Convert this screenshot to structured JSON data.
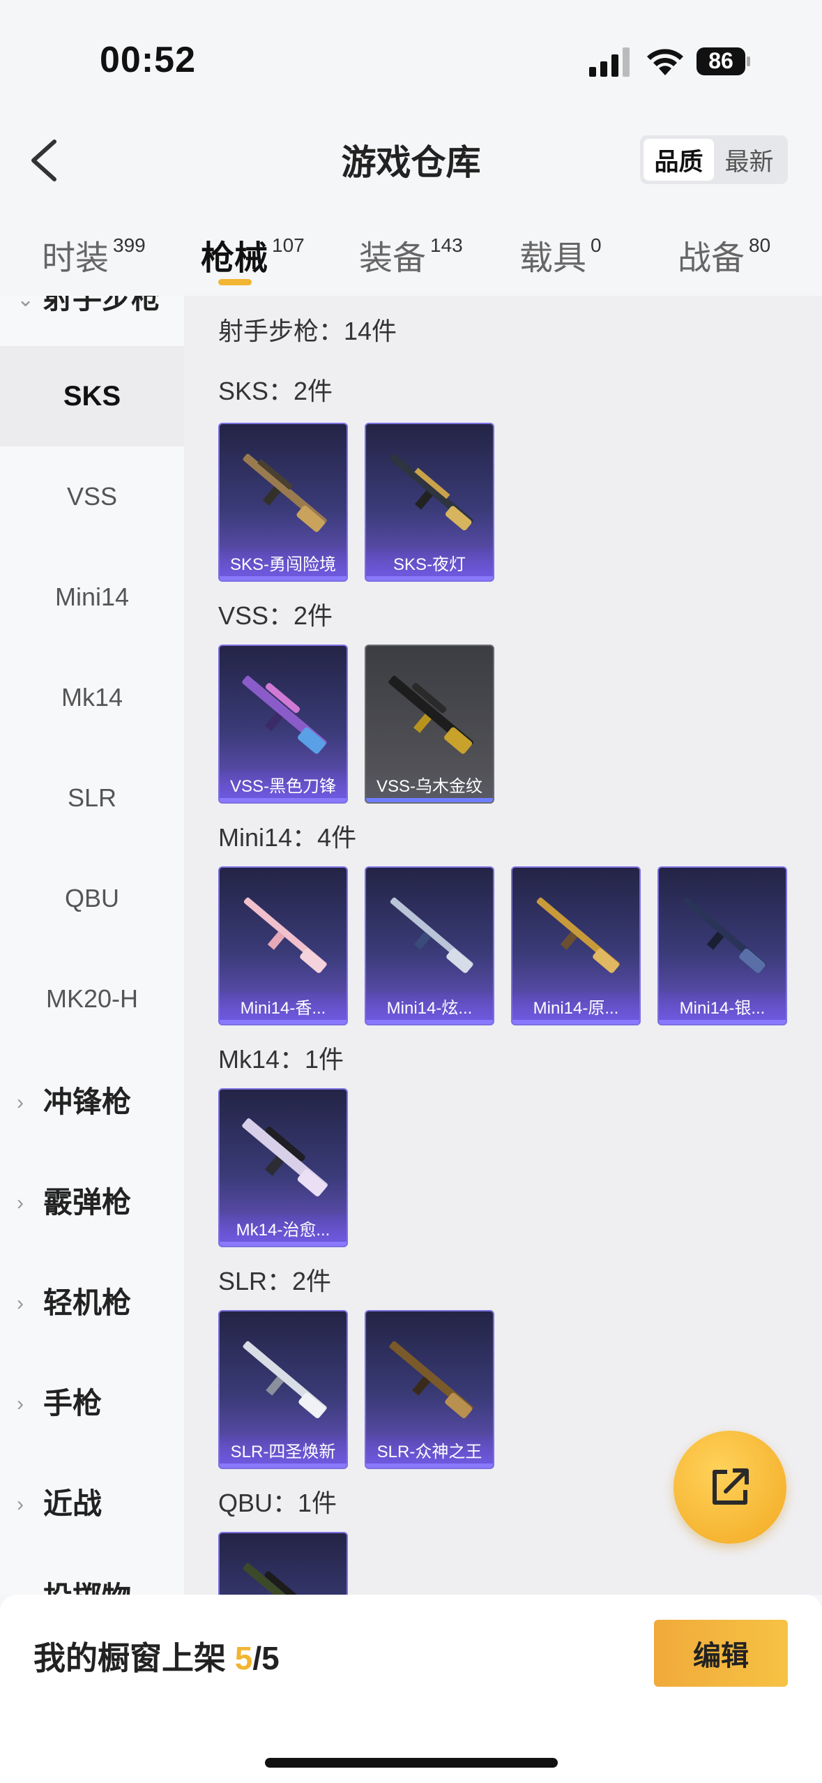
{
  "status": {
    "time": "00:52",
    "battery": "86"
  },
  "header": {
    "title": "游戏仓库",
    "sort_options": [
      "品质",
      "最新"
    ],
    "sort_active": "品质"
  },
  "tabs": [
    {
      "label": "时装",
      "count": "399"
    },
    {
      "label": "枪械",
      "count": "107",
      "active": true
    },
    {
      "label": "装备",
      "count": "143"
    },
    {
      "label": "载具",
      "count": "0"
    },
    {
      "label": "战备",
      "count": "80"
    }
  ],
  "sidebar": {
    "category_partial": "射手步枪",
    "items": [
      "SKS",
      "VSS",
      "Mini14",
      "Mk14",
      "SLR",
      "QBU",
      "MK20-H"
    ],
    "active_item": "SKS",
    "groups": [
      "冲锋枪",
      "霰弹枪",
      "轻机枪",
      "手枪",
      "近战"
    ],
    "group_partial": "投掷物"
  },
  "main": {
    "category_title": "射手步枪：14件",
    "sections": [
      {
        "title": "SKS：2件",
        "items": [
          "SKS-勇闯险境",
          "SKS-夜灯"
        ]
      },
      {
        "title": "VSS：2件",
        "items": [
          "VSS-黑色刀锋",
          "VSS-乌木金纹"
        ]
      },
      {
        "title": "Mini14：4件",
        "items": [
          "Mini14-香...",
          "Mini14-炫...",
          "Mini14-原...",
          "Mini14-银..."
        ]
      },
      {
        "title": "Mk14：1件",
        "items": [
          "Mk14-治愈..."
        ]
      },
      {
        "title": "SLR：2件",
        "items": [
          "SLR-四圣焕新",
          "SLR-众神之王"
        ]
      },
      {
        "title": "QBU：1件",
        "items": []
      }
    ]
  },
  "bottom": {
    "shelf_prefix": "我的橱窗上架 ",
    "shelf_count": "5",
    "shelf_total": "/5",
    "edit_label": "编辑"
  },
  "colors": {
    "accent": "#f2b533",
    "card_purple": "#3a3b78",
    "card_gray": "#57575c"
  }
}
